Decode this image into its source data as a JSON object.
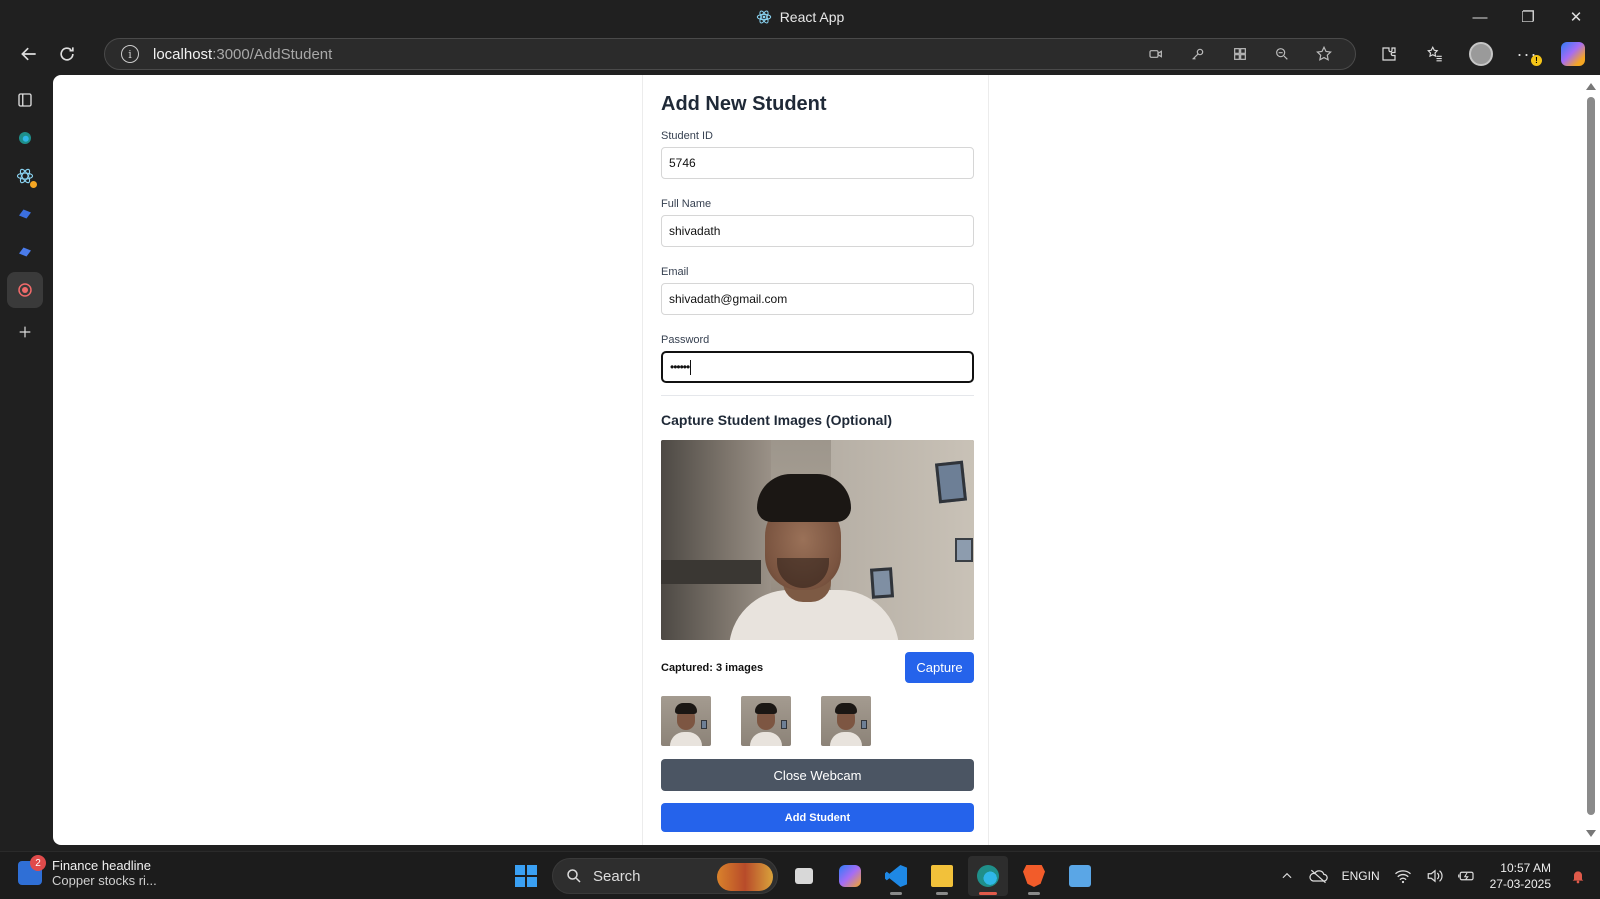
{
  "window": {
    "title": "React App",
    "controls": {
      "minimize": "—",
      "restore": "❐",
      "close": "✕"
    }
  },
  "browser": {
    "url_host": "localhost",
    "url_path": ":3000/AddStudent",
    "icons": [
      "back-icon",
      "refresh-icon",
      "info-icon",
      "camera-icon",
      "key-icon",
      "app-grid-icon",
      "zoom-out-icon",
      "star-icon",
      "extensions-icon",
      "favorites-icon",
      "profile-icon",
      "more-icon",
      "copilot-icon"
    ]
  },
  "sidebar": {
    "items": [
      "tabs-icon",
      "edge-icon",
      "react-icon",
      "tool-icon",
      "tool-icon",
      "record-icon",
      "add-icon"
    ]
  },
  "form": {
    "title": "Add New Student",
    "student_id_label": "Student ID",
    "student_id_value": "5746",
    "full_name_label": "Full Name",
    "full_name_value": "shivadath",
    "email_label": "Email",
    "email_value": "shivadath@gmail.com",
    "password_label": "Password",
    "password_value": "••••••",
    "capture_heading": "Capture Student Images (Optional)",
    "captured_text": "Captured: 3 images",
    "capture_button": "Capture",
    "close_webcam_button": "Close Webcam",
    "add_student_button": "Add Student",
    "thumbnail_count": 3
  },
  "taskbar": {
    "news_badge": "2",
    "news_title": "Finance headline",
    "news_subtitle": "Copper stocks ri...",
    "search_label": "Search",
    "lang_line1": "ENG",
    "lang_line2": "IN",
    "time": "10:57 AM",
    "date": "27-03-2025"
  },
  "colors": {
    "primary_button": "#2563eb",
    "secondary_button": "#4b5563",
    "taskbar_bg": "#1c1c1c"
  }
}
